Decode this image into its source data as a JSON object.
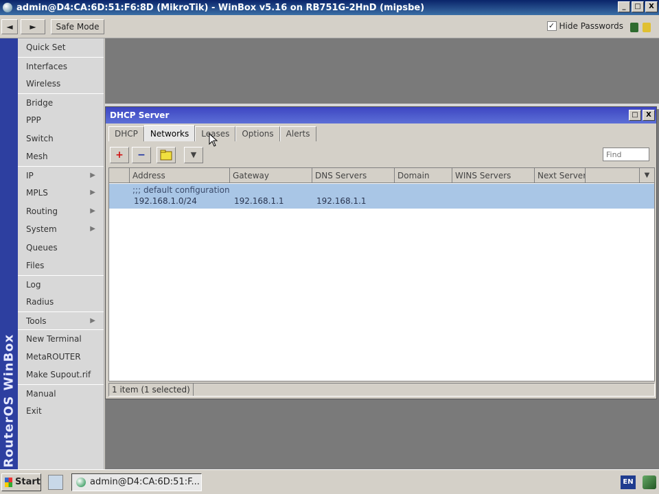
{
  "window": {
    "title": "admin@D4:CA:6D:51:F6:8D (MikroTik) - WinBox v5.16 on RB751G-2HnD (mipsbe)",
    "controls": [
      "_",
      "□",
      "X"
    ]
  },
  "toolbar": {
    "undo_label": "◄",
    "redo_label": "►",
    "safe_mode_label": "Safe Mode",
    "hide_passwords_label": "Hide Passwords",
    "hide_passwords_checked": "✓"
  },
  "brand": {
    "label": "RouterOS WinBox"
  },
  "menu": {
    "items": [
      {
        "label": "Quick Set",
        "arrow": ""
      },
      {
        "label": "Interfaces",
        "arrow": ""
      },
      {
        "label": "Wireless",
        "arrow": ""
      },
      {
        "label": "Bridge",
        "arrow": ""
      },
      {
        "label": "PPP",
        "arrow": ""
      },
      {
        "label": "Switch",
        "arrow": ""
      },
      {
        "label": "Mesh",
        "arrow": ""
      },
      {
        "label": "IP",
        "arrow": "▶"
      },
      {
        "label": "MPLS",
        "arrow": "▶"
      },
      {
        "label": "Routing",
        "arrow": "▶"
      },
      {
        "label": "System",
        "arrow": "▶"
      },
      {
        "label": "Queues",
        "arrow": ""
      },
      {
        "label": "Files",
        "arrow": ""
      },
      {
        "label": "Log",
        "arrow": ""
      },
      {
        "label": "Radius",
        "arrow": ""
      },
      {
        "label": "Tools",
        "arrow": "▶"
      },
      {
        "label": "New Terminal",
        "arrow": ""
      },
      {
        "label": "MetaROUTER",
        "arrow": ""
      },
      {
        "label": "Make Supout.rif",
        "arrow": ""
      },
      {
        "label": "Manual",
        "arrow": ""
      },
      {
        "label": "Exit",
        "arrow": ""
      }
    ]
  },
  "dhcp_window": {
    "title": "DHCP Server",
    "controls": [
      "□",
      "X"
    ],
    "tabs": [
      "DHCP",
      "Networks",
      "Leases",
      "Options",
      "Alerts"
    ],
    "active_tab": "Networks",
    "tools": {
      "add": "+",
      "remove": "−",
      "comment": "",
      "filter": "▼"
    },
    "find_placeholder": "Find",
    "columns": [
      "",
      "Address",
      "Gateway",
      "DNS Servers",
      "Domain",
      "WINS Servers",
      "Next Server"
    ],
    "rows": [
      {
        "comment": ";;; default configuration",
        "address": "192.168.1.0/24",
        "gateway": "192.168.1.1",
        "dns_servers": "192.168.1.1",
        "domain": "",
        "wins_servers": "",
        "next_server": ""
      }
    ],
    "status": "1 item (1 selected)"
  },
  "taskbar": {
    "start_label": "Start",
    "task_label": "admin@D4:CA:6D:51:F...",
    "language": "EN"
  },
  "colors": {
    "title_bar": "#0a246a",
    "brand_strip": "#2d3fa0",
    "dhcp_title": "#3d46c2",
    "selected_row": "#a9c6e6",
    "workarea": "#7a7a7a"
  }
}
